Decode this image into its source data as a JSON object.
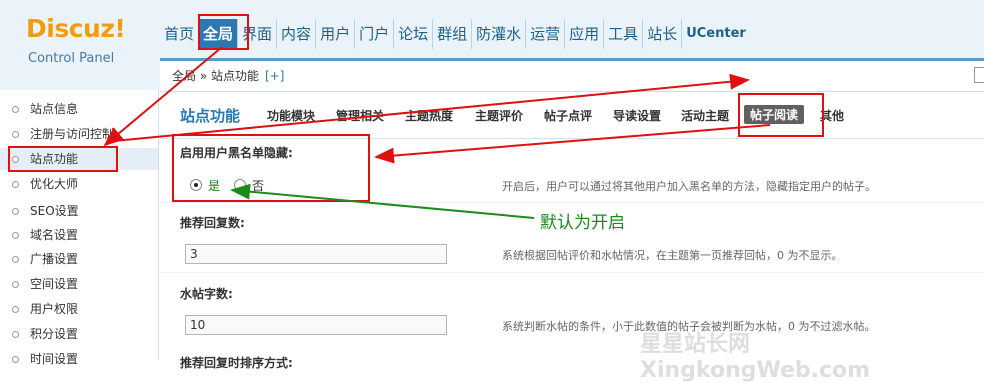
{
  "logo": {
    "brand": "Discuz!",
    "subtitle": "Control Panel"
  },
  "topnav": [
    "首页",
    "全局",
    "界面",
    "内容",
    "用户",
    "门户",
    "论坛",
    "群组",
    "防灌水",
    "运营",
    "应用",
    "工具",
    "站长",
    "UCenter"
  ],
  "breadcrumb": {
    "path": "全局 » 站点功能",
    "add": "[+]"
  },
  "sidebar": [
    "站点信息",
    "注册与访问控制",
    "站点功能",
    "优化大师",
    "SEO设置",
    "域名设置",
    "广播设置",
    "空间设置",
    "用户权限",
    "积分设置",
    "时间设置"
  ],
  "content": {
    "section_title": "站点功能",
    "tabs": [
      "功能模块",
      "管理相关",
      "主题热度",
      "主题评价",
      "帖子点评",
      "导读设置",
      "活动主题",
      "帖子阅读",
      "其他"
    ],
    "blacklist": {
      "heading": "启用用户黑名单隐藏:",
      "option_yes": "是",
      "option_no": "否",
      "desc": "开启后，用户可以通过将其他用户加入黑名单的方法，隐藏指定用户的帖子。"
    },
    "recommend": {
      "heading": "推荐回复数:",
      "value": "3",
      "desc": "系统根据回帖评价和水帖情况，在主题第一页推荐回帖，0 为不显示。"
    },
    "water": {
      "heading": "水帖字数:",
      "value": "10",
      "desc": "系统判断水帖的条件，小于此数值的帖子会被判断为水帖，0 为不过滤水帖。"
    },
    "next_heading": "推荐回复时排序方式:"
  },
  "annotation": {
    "note": "默认为开启"
  },
  "watermark": "星星站长网 XingkongWeb.com",
  "colors": {
    "accent": "#2a79b4",
    "annotation_red": "#e01010",
    "annotation_green": "#1b8c1b",
    "logo_orange": "#f39c12"
  }
}
